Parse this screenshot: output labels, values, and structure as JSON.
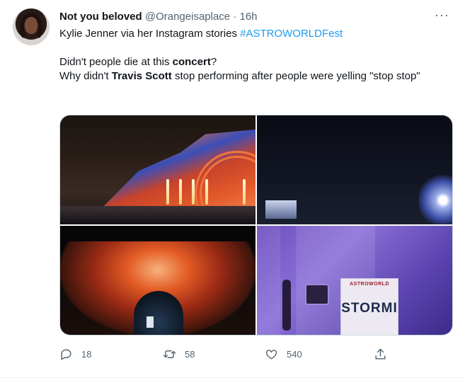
{
  "tweet": {
    "author_name": "Not you beloved",
    "handle": "@Orangeisaplace",
    "separator": "·",
    "time": "16h",
    "more_label": "···",
    "text_line1_prefix": "Kylie Jenner via her Instagram stories ",
    "hashtag": "#ASTROWORLDFest",
    "text_line2_prefix": "Didn't people die at this ",
    "text_line2_bold": "concert",
    "text_line2_suffix": "?",
    "text_line3_prefix": "Why didn't ",
    "text_line3_bold": "Travis Scott",
    "text_line3_suffix": " stop performing after people were yelling \"stop stop\""
  },
  "media": {
    "images": [
      {
        "name": "stage-fireworks-image"
      },
      {
        "name": "dark-crowd-image"
      },
      {
        "name": "volcano-stage-image"
      },
      {
        "name": "trailer-door-image",
        "sign_top": "ASTROWORLD",
        "sign_text": "STORMI"
      }
    ]
  },
  "actions": {
    "reply_count": "18",
    "retweet_count": "58",
    "like_count": "540"
  },
  "colors": {
    "link": "#1d9bf0",
    "secondary_text": "#536471",
    "primary_text": "#0f1419"
  },
  "icons": [
    "more-icon",
    "reply-icon",
    "retweet-icon",
    "like-icon",
    "share-icon"
  ]
}
